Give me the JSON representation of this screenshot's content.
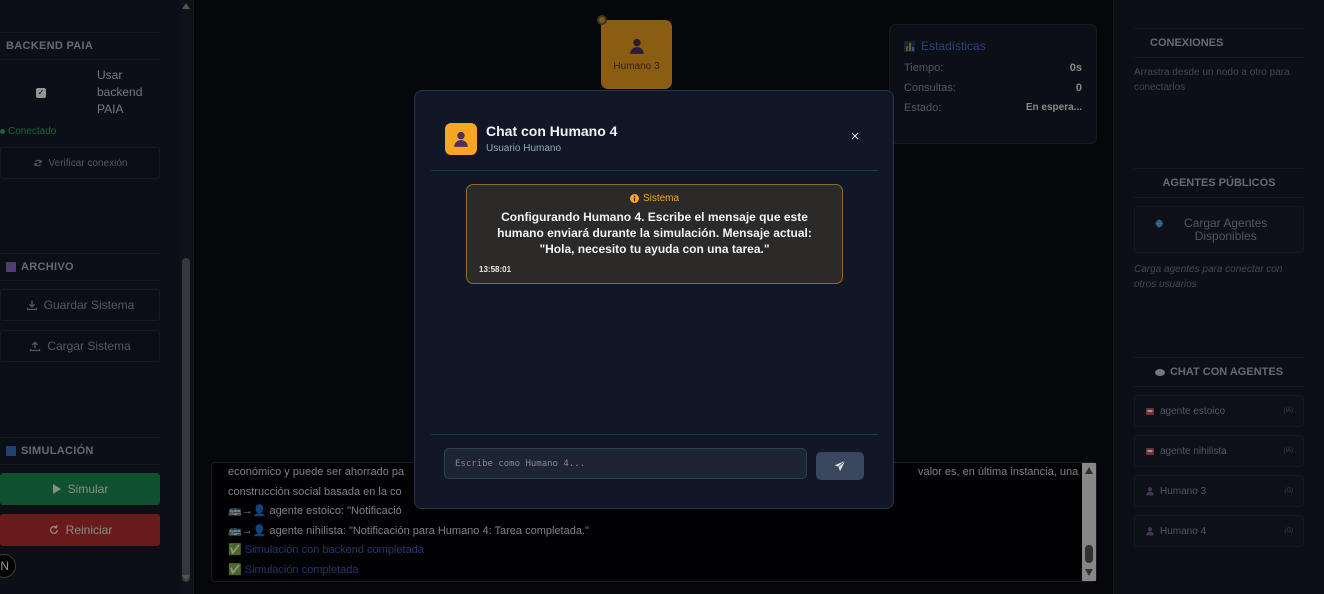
{
  "left": {
    "backend_title": "BACKEND PAIA",
    "use_backend_label": "Usar backend PAIA",
    "checkbox_mark": "✓",
    "connected_status": "Conectado",
    "verify_button": "Verificar conexión",
    "archive_title": "ARCHIVO",
    "save_button": "Guardar Sistema",
    "load_button": "Cargar Sistema",
    "simulation_title": "SIMULACIÓN",
    "simulate_button": "Simular",
    "reset_button": "Reiniciar"
  },
  "canvas": {
    "node_label": "Humano 3",
    "stats": {
      "title": "Estadísticas",
      "rows": [
        {
          "label": "Tiempo:",
          "value": "0s"
        },
        {
          "label": "Consultas:",
          "value": "0"
        },
        {
          "label": "Estado:",
          "value": "En espera..."
        }
      ]
    },
    "log": [
      {
        "text": "económico y puede ser ahorrado pa",
        "tail": "valor es, en última instancia, una",
        "kind": "plain"
      },
      {
        "text": "construcción social basada en la co",
        "kind": "plain"
      },
      {
        "text": "🚌→👤 agente estoico: \"Notificació",
        "kind": "plain"
      },
      {
        "text": "🚌→👤 agente nihilista: \"Notificación para Humano 4: Tarea completada.\"",
        "kind": "plain"
      },
      {
        "text": "✅ Simulación con backend completada",
        "kind": "blue"
      },
      {
        "text": "✅ Simulación completada",
        "kind": "blue"
      }
    ]
  },
  "right": {
    "connections_title": "CONEXIONES",
    "connections_help": "Arrastra desde un nodo a otro para conectarlos",
    "public_agents_title": "AGENTES PÚBLICOS",
    "load_agents_button": "Cargar Agentes Disponibles",
    "public_agents_help": "Carga agentes para conectar con otros usuarios",
    "chat_title": "CHAT CON AGENTES",
    "chat_items": [
      {
        "name": "agente estoico",
        "tag": "(IA)",
        "icon": "robot-icon"
      },
      {
        "name": "agente nihilista",
        "tag": "(IA)",
        "icon": "robot-icon"
      },
      {
        "name": "Humano 3",
        "tag": "(G)",
        "icon": "user-icon"
      },
      {
        "name": "Humano 4",
        "tag": "(G)",
        "icon": "user-icon"
      }
    ]
  },
  "modal": {
    "title": "Chat con Humano 4",
    "subtitle": "Usuario Humano",
    "close": "×",
    "system_message": {
      "sender": "Sistema",
      "text": "Configurando Humano 4. Escribe el mensaje que este humano enviará durante la simulación. Mensaje actual: \"Hola, necesito tu ayuda con una tarea.\"",
      "time": "13:58:01"
    },
    "input_placeholder": "Escribe como Humano 4...",
    "input_value": ""
  },
  "colors": {
    "accent_orange": "#f5a623",
    "success_green": "#1a8a50",
    "danger_red": "#b52f2f",
    "link_blue": "#3f5ab8"
  }
}
